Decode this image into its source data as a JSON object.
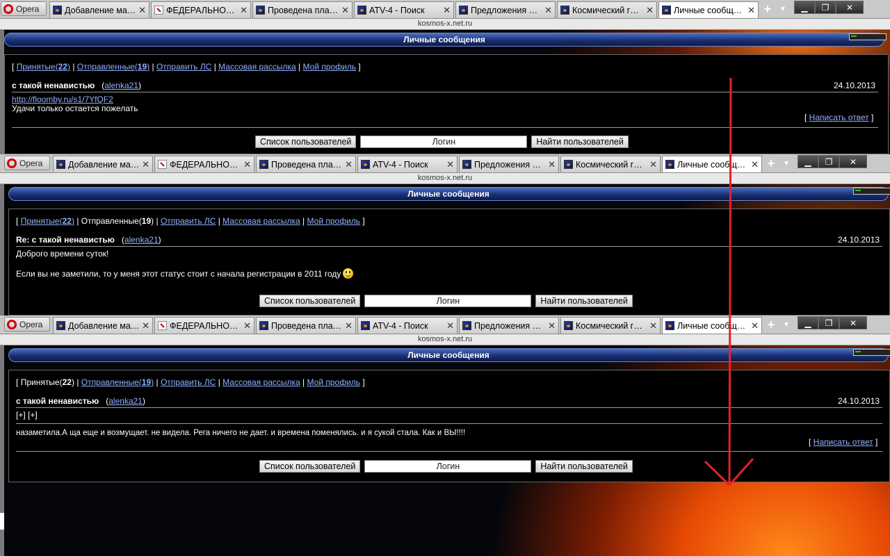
{
  "browser": {
    "opera_label": "Opera",
    "tabs": [
      {
        "label": "Добавление мате...",
        "favicon": "site-icon"
      },
      {
        "label": "ФЕДЕРАЛЬНОЕ К...",
        "favicon": "red-logo-icon"
      },
      {
        "label": "Проведена плано...",
        "favicon": "site-icon"
      },
      {
        "label": "ATV-4 - Поиск",
        "favicon": "site-icon"
      },
      {
        "label": "Предложения по ...",
        "favicon": "site-icon"
      },
      {
        "label": "Космический гру...",
        "favicon": "site-icon"
      },
      {
        "label": "Личные сообще...",
        "favicon": "site-icon",
        "active": true
      }
    ],
    "address": "kosmos-x.net.ru"
  },
  "page": {
    "header_title": "Личные сообщения",
    "nav": {
      "open": "[",
      "inbox": "Принятые",
      "inbox_count": "22",
      "sent": "Отправленные",
      "sent_count": "19",
      "send": "Отправить ЛС",
      "mass": "Массовая рассылка",
      "profile": "Мой профиль",
      "close": "]",
      "sep": "|"
    },
    "buttons": {
      "user_list": "Список пользователей",
      "login_placeholder": "Логин",
      "find_users": "Найти пользователей"
    },
    "reply_label": "Написать ответ"
  },
  "messages": [
    {
      "subject": "с такой ненавистью",
      "author": "alenka21",
      "date": "24.10.2013",
      "link": "http://floomby.ru/s1/7YfQF2",
      "text": "Удачи только остается пожелать"
    },
    {
      "subject": "Re: с такой ненавистью",
      "author": "alenka21",
      "date": "24.10.2013",
      "line1": "Доброго времени суток!",
      "line2": "Если вы не заметили, то у меня этот статус стоит с начала регистрации в 2011 году"
    },
    {
      "subject": "с такой ненавистью",
      "author": "alenka21",
      "date": "24.10.2013",
      "expand1": "[+]",
      "expand2": "[+]",
      "text": "назаметила.А ща еще и возмущает. не видела. Рега ничего не дает. и времена поменялись. и я сукой стала. Как и ВЫ!!!!"
    }
  ],
  "colors": {
    "arrow": "#e8202a",
    "link": "#8fb0ff"
  }
}
